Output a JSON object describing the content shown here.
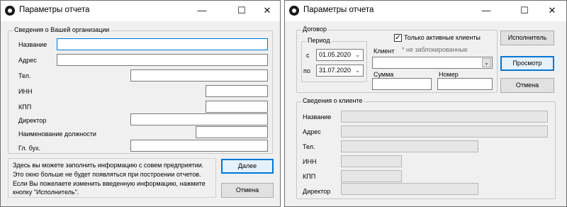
{
  "left_window": {
    "title": "Параметры отчета",
    "controls": {
      "minimize": "—",
      "maximize": "☐",
      "close": "✕"
    },
    "org_group": {
      "legend": "Сведения о Вашей организации",
      "fields": {
        "name": {
          "label": "Название",
          "value": ""
        },
        "address": {
          "label": "Адрес",
          "value": ""
        },
        "phone": {
          "label": "Тел.",
          "value": ""
        },
        "inn": {
          "label": "ИНН",
          "value": ""
        },
        "kpp": {
          "label": "КПП",
          "value": ""
        },
        "director": {
          "label": "Директор",
          "value": ""
        },
        "position": {
          "label": "Наименование должности",
          "value": ""
        },
        "accountant": {
          "label": "Гл. бух.",
          "value": ""
        }
      }
    },
    "info": {
      "line1": "Здесь вы можете заполнить информацию с совем предприятии.",
      "line2": "Это окно больше не будет появляться при построении отчетов.",
      "line3": "Если Вы пожелаете изменить введенную информацию, нажмите",
      "line4": "кнопку \"Исполнитель\"."
    },
    "buttons": {
      "next": "Далее",
      "cancel": "Отмена"
    }
  },
  "right_window": {
    "title": "Параметры отчета",
    "controls": {
      "minimize": "—",
      "maximize": "☐",
      "close": "✕"
    },
    "contract_group": {
      "legend": "Договор",
      "period_legend": "Период",
      "from_label": "с",
      "from_value": "01.05.2020",
      "to_label": "по",
      "to_value": "31.07.2020",
      "active_only_label": "Только активные клиенты",
      "active_only_checked": true,
      "not_blocked_note": "* не заблокированные",
      "client_label": "Клиент",
      "client_value": "",
      "sum_label": "Сумма",
      "sum_value": "",
      "number_label": "Номер",
      "number_value": ""
    },
    "buttons": {
      "executor": "Исполнитель",
      "preview": "Просмотр",
      "cancel": "Отмена"
    },
    "client_group": {
      "legend": "Сведения о клиенте",
      "fields": {
        "name": {
          "label": "Название",
          "value": ""
        },
        "address": {
          "label": "Адрес",
          "value": ""
        },
        "phone": {
          "label": "Тел.",
          "value": ""
        },
        "inn": {
          "label": "ИНН",
          "value": ""
        },
        "kpp": {
          "label": "КПП",
          "value": ""
        },
        "director": {
          "label": "Директор",
          "value": ""
        }
      }
    }
  },
  "colors": {
    "focus": "#0078d7",
    "window_bg": "#f0f0f0",
    "readonly_field": "#e6e6e6"
  }
}
